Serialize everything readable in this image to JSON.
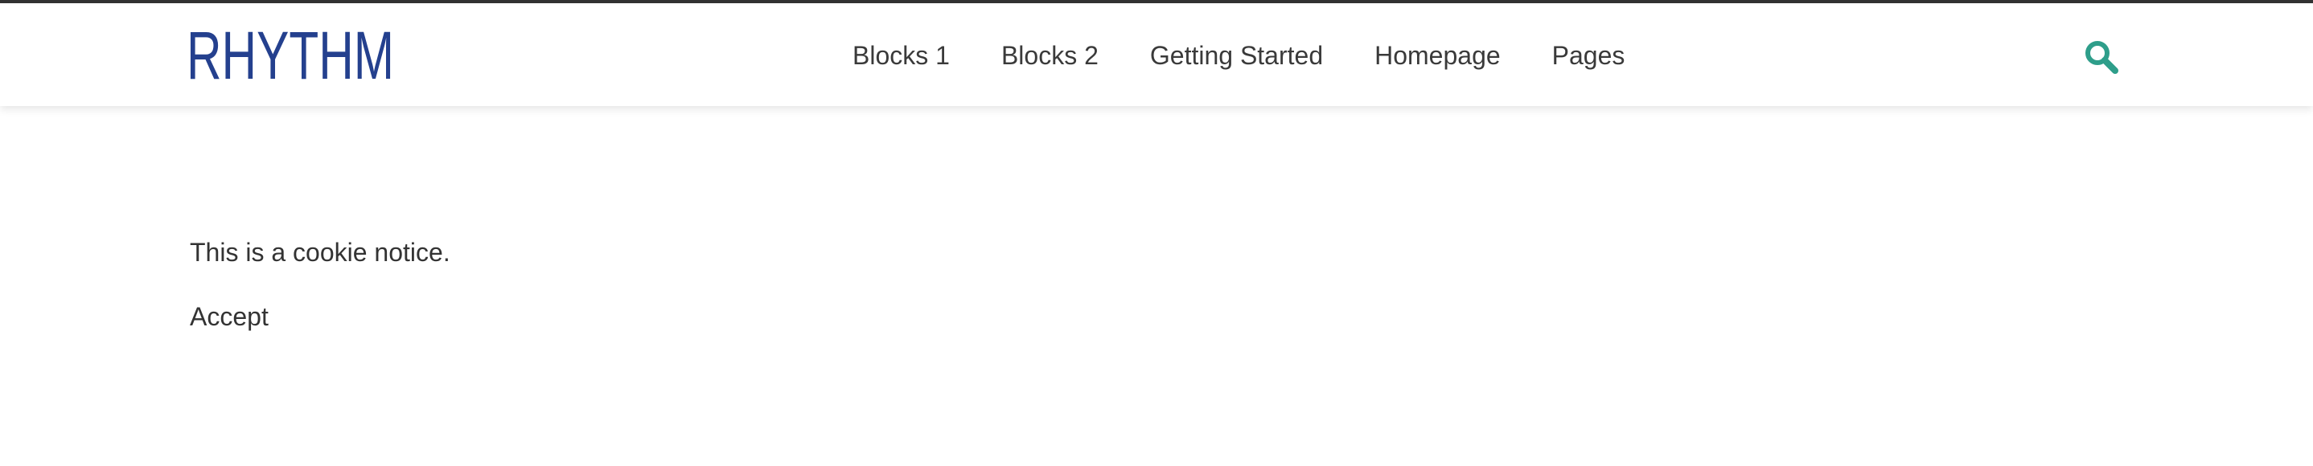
{
  "header": {
    "logo_text": "RHYTHM",
    "logo_color": "#24408e",
    "accent_color": "#2e9e8a",
    "nav": [
      {
        "label": "Blocks 1"
      },
      {
        "label": "Blocks 2"
      },
      {
        "label": "Getting Started"
      },
      {
        "label": "Homepage"
      },
      {
        "label": "Pages"
      }
    ],
    "search_icon": "search-icon"
  },
  "cookie_notice": {
    "text": "This is a cookie notice.",
    "accept_label": "Accept"
  }
}
